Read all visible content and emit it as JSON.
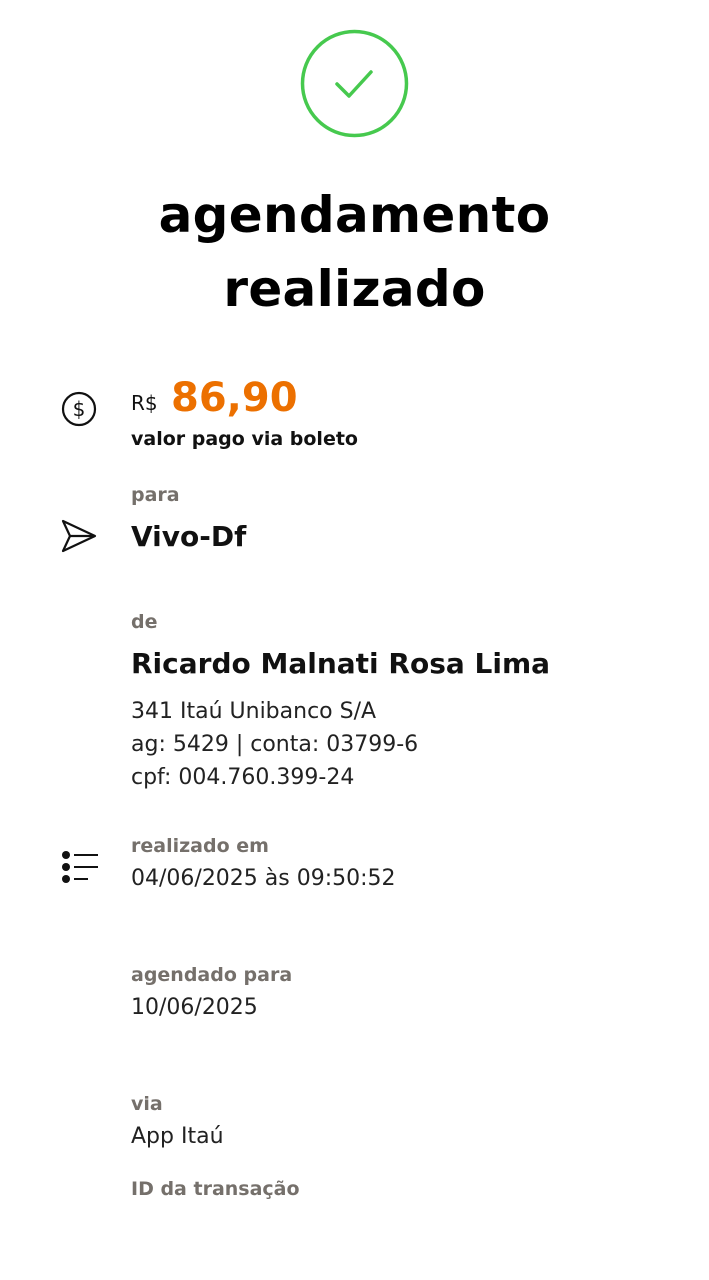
{
  "status": {
    "icon": "check-circle-icon",
    "color": "#46c94e",
    "title_line1": "agendamento",
    "title_line2": "realizado"
  },
  "payment": {
    "icon": "dollar-circle-icon",
    "currency": "R$",
    "amount": "86,90",
    "amount_color": "#ec7000",
    "caption": "valor pago via boleto"
  },
  "payee": {
    "icon": "send-icon",
    "label": "para",
    "name": "Vivo-Df"
  },
  "payer": {
    "label": "de",
    "name": "Ricardo Malnati Rosa Lima",
    "bank": "341 Itaú Unibanco S/A",
    "account": "ag: 5429 | conta: 03799-6",
    "cpf": "cpf: 004.760.399-24"
  },
  "details": {
    "icon": "list-icon",
    "realized_label": "realizado em",
    "realized_value": "04/06/2025 às 09:50:52",
    "scheduled_label": "agendado para",
    "scheduled_value": "10/06/2025",
    "via_label": "via",
    "via_value": "App Itaú",
    "transaction_id_label": "ID da transação"
  }
}
